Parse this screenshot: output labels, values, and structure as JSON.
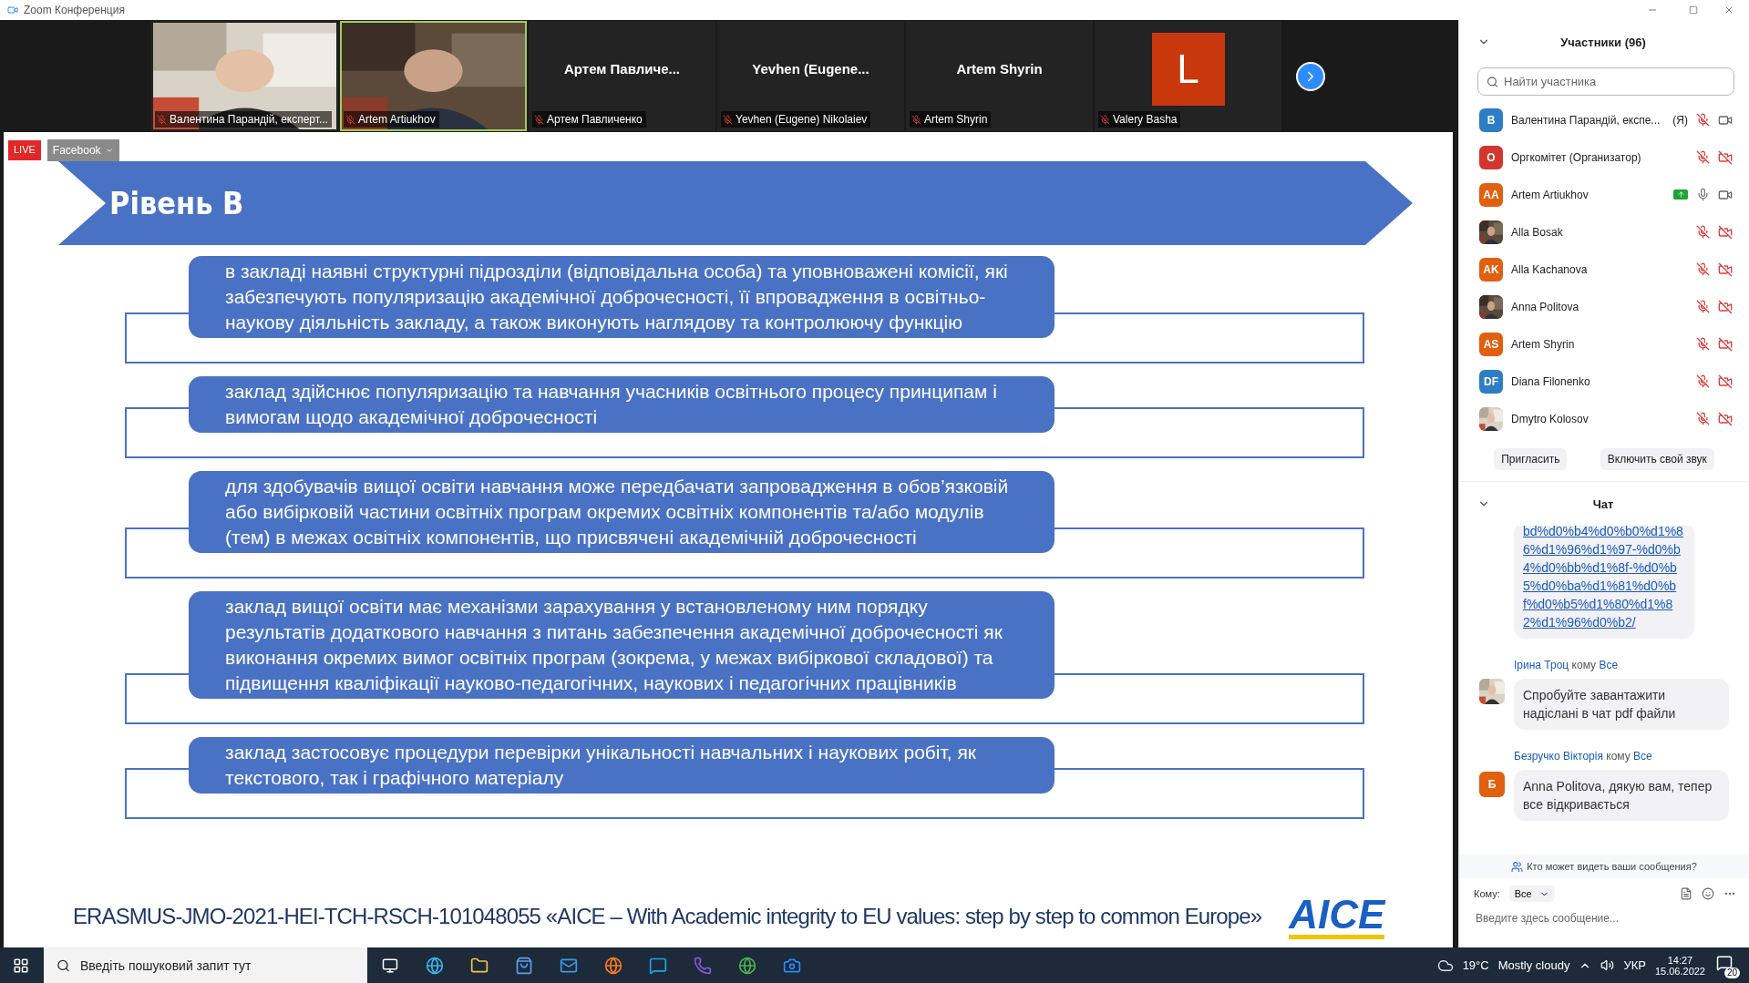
{
  "window": {
    "title": "Zoom Конференция"
  },
  "videos": [
    {
      "name": "Валентина Парандій, експерт...",
      "kind": "picture",
      "speaking": false
    },
    {
      "name": "Artem Artiukhov",
      "kind": "picture",
      "speaking": true
    },
    {
      "name": "Артем Павличенко",
      "kind": "name",
      "title": "Артем  Павличе...",
      "speaking": false
    },
    {
      "name": "Yevhen (Eugene) Nikolaiev",
      "kind": "name",
      "title": "Yevhen  (Eugene...",
      "speaking": false
    },
    {
      "name": "Artem Shyrin",
      "kind": "name",
      "title": "Artem Shyrin",
      "speaking": false
    },
    {
      "name": "Valery Basha",
      "kind": "letter",
      "letter": "L",
      "color": "#c8380c",
      "speaking": false
    }
  ],
  "live": {
    "badge": "LIVE",
    "target": "Facebook"
  },
  "slide": {
    "title": "Рівень В",
    "items": [
      "в закладі наявні структурні підрозділи (відповідальна особа) та уповноважені комісії, які забезпечують популяризацію академічної доброчесності, її впровадження в освітньо-наукову діяльність закладу, а також виконують наглядову та контролюючу функцію",
      "заклад здійснює популяризацію та навчання учасників освітнього процесу принципам і вимогам щодо академічної доброчесності",
      "для здобувачів вищої освіти навчання може передбачати запровадження в обов’язковій або вибірковій частини освітніх програм окремих освітніх компонентів та/або модулів (тем) в межах освітніх компонентів, що присвячені академічній доброчесності",
      "заклад вищої освіти має механізми зарахування у встановленому ним порядку результатів додаткового навчання з питань забезпечення академічної доброчесності як виконання окремих вимог освітніх програм (зокрема, у межах вибіркової складової) та підвищення кваліфікації науково-педагогічних, наукових і педагогічних працівників",
      "заклад застосовує процедури перевірки унікальності  навчальних і наукових робіт, як текстового, так і графічного матеріалу"
    ],
    "footer": "ERASMUS-JMO-2021-HEI-TCH-RSCH-101048055 «AICE – With Academic integrity to EU values: step by step to common Europe»",
    "logo": "AICE"
  },
  "participants": {
    "title": "Участники (96)",
    "search_placeholder": "Найти участника",
    "list": [
      {
        "name": "Валентина Парандій, експе...",
        "tag": "(Я)",
        "kind": "initials",
        "initials": "В",
        "color": "#2d7dc4",
        "muted": true,
        "video_off": false,
        "sharing": false
      },
      {
        "name": "Оргкомітет (Организатор)",
        "kind": "initials",
        "initials": "О",
        "color": "#d2362e",
        "muted": true,
        "video_off": true,
        "sharing": false
      },
      {
        "name": "Artem Artiukhov",
        "kind": "initials",
        "initials": "AA",
        "color": "#e0600f",
        "muted": false,
        "video_off": false,
        "sharing": true
      },
      {
        "name": "Alla Bosak",
        "kind": "picture",
        "muted": true,
        "video_off": true,
        "sharing": false
      },
      {
        "name": "Alla Kachanova",
        "kind": "initials",
        "initials": "AK",
        "color": "#e0600f",
        "muted": true,
        "video_off": true,
        "sharing": false
      },
      {
        "name": "Anna Politova",
        "kind": "picture",
        "muted": true,
        "video_off": true,
        "sharing": false
      },
      {
        "name": "Artem Shyrin",
        "kind": "initials",
        "initials": "AS",
        "color": "#e0600f",
        "muted": true,
        "video_off": true,
        "sharing": false
      },
      {
        "name": "Diana Filonenko",
        "kind": "initials",
        "initials": "DF",
        "color": "#2d7dc4",
        "muted": true,
        "video_off": true,
        "sharing": false
      },
      {
        "name": "Dmytro Kolosov",
        "kind": "picture",
        "muted": true,
        "video_off": true,
        "sharing": false
      }
    ],
    "buttons": [
      "Пригласить",
      "Включить свой звук"
    ]
  },
  "chat": {
    "title": "Чат",
    "messages": [
      {
        "kind": "link",
        "text": "bd%d0%b4%d0%b0%d1%86%d1%96%d1%97-%d0%b4%d0%bb%d1%8f-%d0%b5%d0%ba%d1%81%d0%bf%d0%b5%d1%80%d1%82%d1%96%d0%b2/"
      },
      {
        "kind": "message",
        "sender": "Ірина Троц",
        "to_word": "кому",
        "to": "Все",
        "text": "Спробуйте завантажити надіслані в чат pdf файли"
      },
      {
        "kind": "message",
        "sender": "Безручко Вікторія",
        "to_word": "кому",
        "to": "Все",
        "initials": "Б",
        "color": "#e0600f",
        "text": "Anna Politova, дякую вам, тепер все відкривається"
      }
    ],
    "privacy": "Кто может видеть ваши сообщения?",
    "to_label": "Кому:",
    "to_value": "Все",
    "input_placeholder": "Введите здесь сообщение..."
  },
  "taskbar": {
    "search_placeholder": "Введіть пошуковий запит тут",
    "temperature": "19°C",
    "weather": "Mostly cloudy",
    "language": "УКР",
    "time": "14:27",
    "date": "15.06.2022",
    "notifications": "20"
  }
}
